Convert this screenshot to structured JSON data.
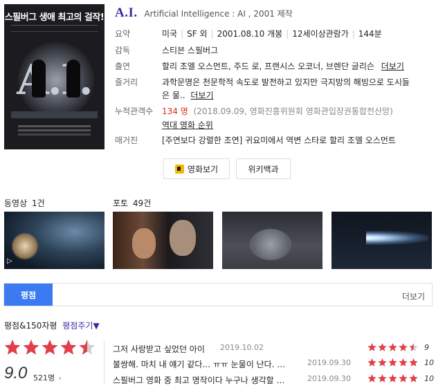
{
  "poster": {
    "tagline": "스필버그 생애 최고의 걸작!",
    "title_art": "A.I."
  },
  "title": {
    "main": "A.I.",
    "english": "Artificial Intelligence : AI , 2001 제작"
  },
  "info": {
    "summary_label": "요약",
    "summary": [
      "미국",
      "SF 외",
      "2001.08.10 개봉",
      "12세이상관람가",
      "144분"
    ],
    "director_label": "감독",
    "director": "스티븐 스필버그",
    "cast_label": "출연",
    "cast": "할리 조엘 오스먼트, 주드 로, 프랜시스 오코너, 브렌단 글리슨",
    "cast_more": "더보기",
    "plot_label": "줄거리",
    "plot_line1": "과학문명은 천문학적 속도로 발전하고 있지만 극지방의 해빙으로 도시들",
    "plot_line2": "은 물..",
    "plot_more": "더보기",
    "audience_label": "누적관객수",
    "audience_count": "134 명",
    "audience_source": "(2018.09.09, 영화진흥위원회 영화관입장권통합전산망)",
    "rank_link": "역대 영화 순위",
    "magazine_label": "매거진",
    "magazine": "[주연보다 강렬한 조연] 귀요미에서 역변 스타로 할리 조엘 오스먼트"
  },
  "buttons": {
    "watch": "영화보기",
    "wiki": "위키백과"
  },
  "media": {
    "video_label": "동영상",
    "video_count": "1건",
    "photo_label": "포토",
    "photo_count": "49건"
  },
  "rating_tab": {
    "active": "평점",
    "more": "더보기"
  },
  "rating_head": {
    "label": "평점&150자평",
    "give": "평점주기",
    "give_icon": "▼"
  },
  "rating_summary": {
    "score": "9.0",
    "stars": 4.5,
    "count": "521명",
    "count_arrow": "›"
  },
  "reviews": [
    {
      "text": "그저 사랑받고 싶었던 아이",
      "date": "2019.10.02",
      "stars": 4.5,
      "score": "9"
    },
    {
      "text": "불쌍해. 마치 내 얘기 같다... ㅠㅠ 눈물이 난다. …",
      "date": "2019.09.30",
      "stars": 5,
      "score": "10"
    },
    {
      "text": "스필버그 영화 중 최고 명작이다 누구나 생각할 …",
      "date": "2019.09.30",
      "stars": 5,
      "score": "10"
    }
  ],
  "colors": {
    "accent_blue": "#3b7af0",
    "title_purple": "#3b2aa8",
    "star_red": "#e1404a",
    "count_red": "#e1251b"
  }
}
